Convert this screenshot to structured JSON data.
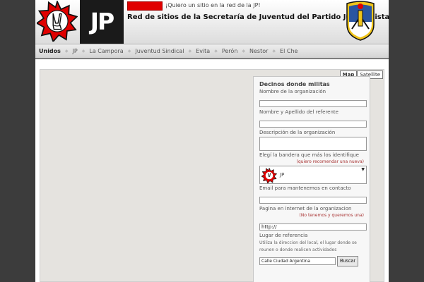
{
  "header": {
    "want_link": "¡Quiero un sitio en la red de la JP!",
    "logo_text": "JP",
    "title": "Red de sitios de la Secretaría de Juventud del Partido Justicialista"
  },
  "nav": {
    "items": [
      "Unidos",
      "JP",
      "La Campora",
      "Juventud Sindical",
      "Evita",
      "Perón",
      "Nestor",
      "El Che"
    ],
    "active": "Unidos"
  },
  "map": {
    "map_label": "Map",
    "satellite_label": "Satellite",
    "active": "Map"
  },
  "form": {
    "title": "Decinos donde militas",
    "org_name_label": "Nombre de la organización",
    "org_name_value": "",
    "contact_label": "Nombre y Apellido del referente",
    "contact_value": "",
    "description_label": "Descripción de la organización",
    "description_value": "",
    "flag_label": "Elegí la bandera que más los identifique",
    "flag_recommend_link": "(quiero recomendar una nueva)",
    "flag_selected": "JP",
    "email_label": "Email para mantenemos en contacto",
    "email_value": "",
    "web_label": "Pagina en internet de la organizacion",
    "web_no_link": "(No tenemos y queremos una)",
    "web_value": "http://",
    "ref_label": "Lugar de referencia",
    "ref_hint": "Utiliza la direccion del local, el lugar donde se reunen o donde realicen actividades",
    "ref_value": "Calle Ciudad Argentina",
    "search_button": "Buscar"
  },
  "colors": {
    "flag_red": "#e00000",
    "pj_blue": "#2a55a0",
    "pj_yellow": "#f0c419",
    "background": "#3c3c3c"
  },
  "icons": {
    "star_logo": "red-star-with-v-hand-icon",
    "shield_logo": "pj-shield-icon"
  }
}
